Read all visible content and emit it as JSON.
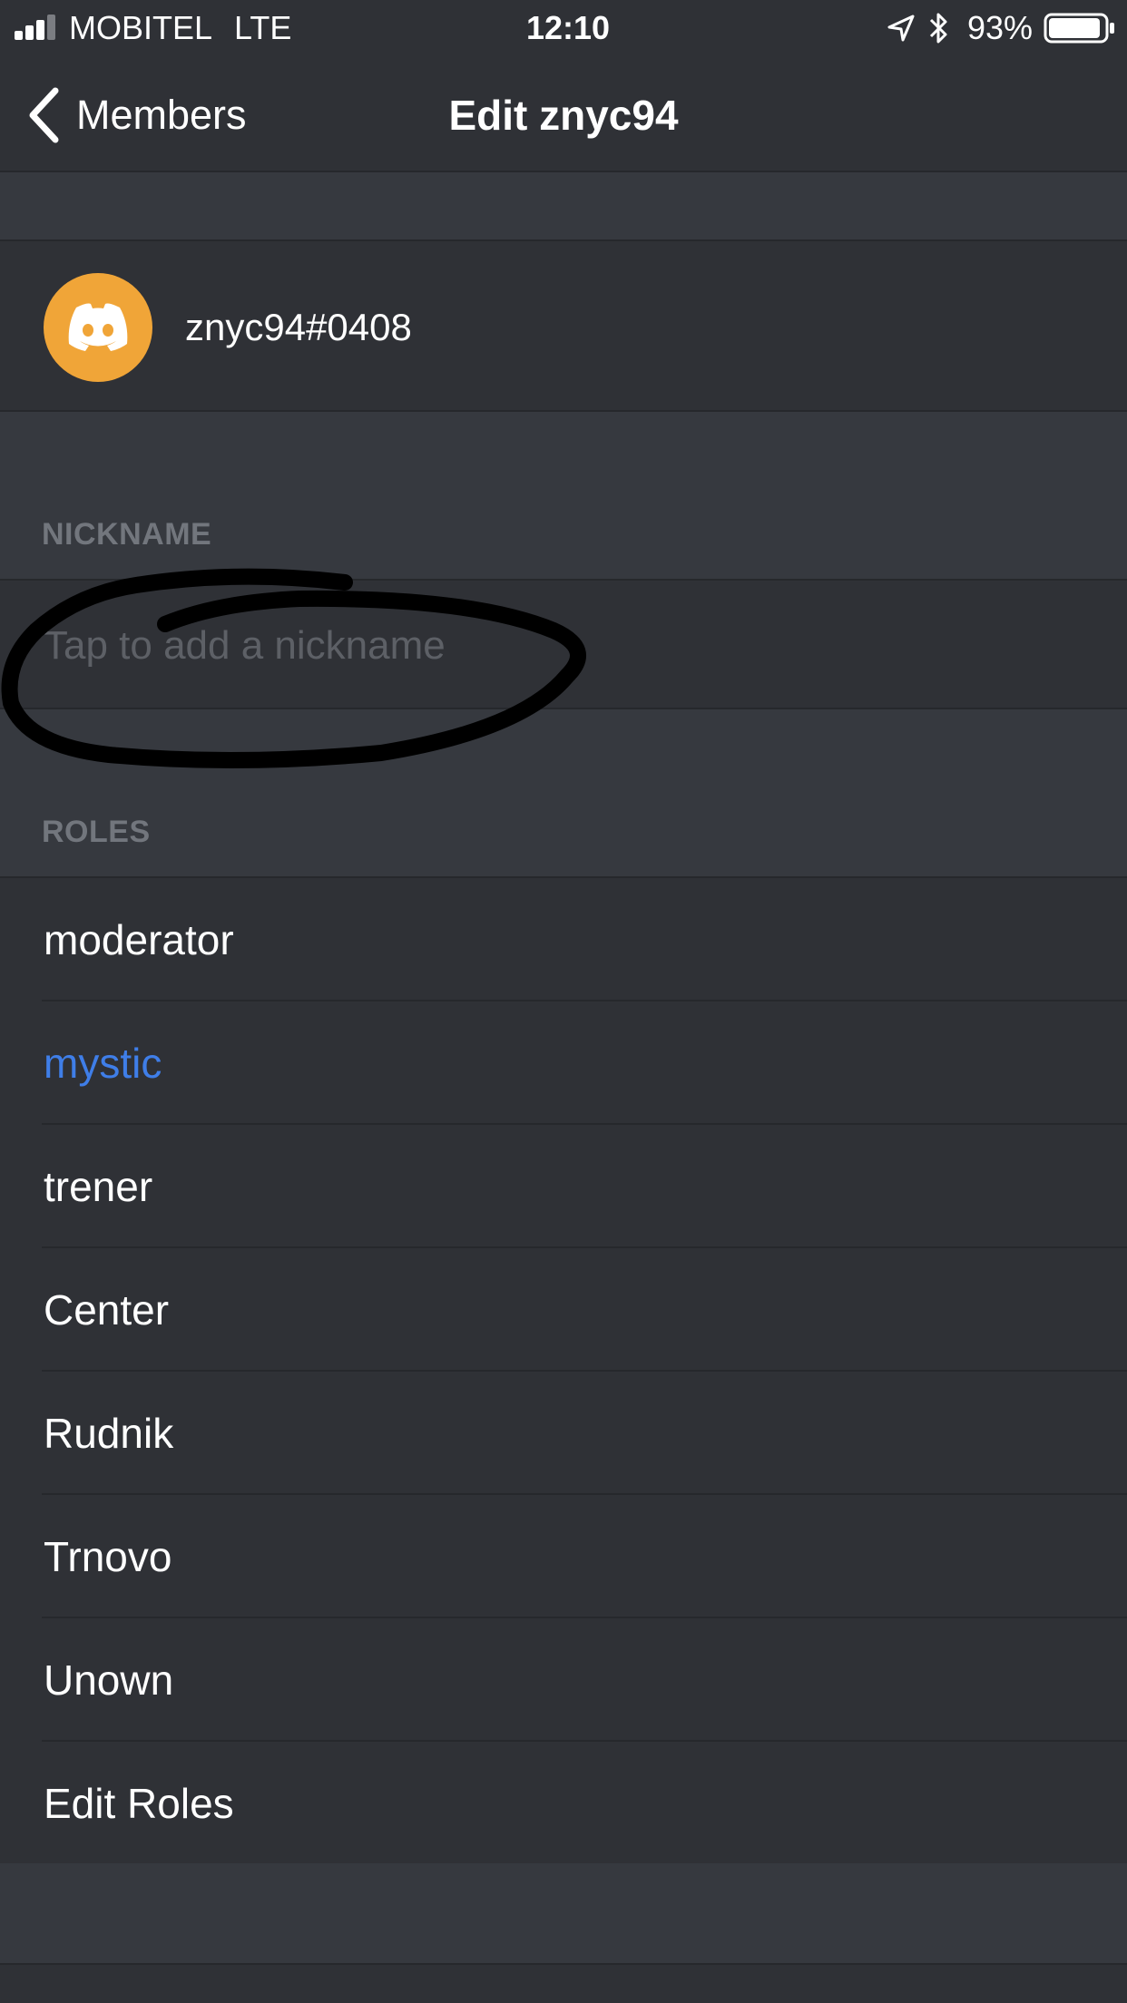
{
  "status_bar": {
    "carrier": "MOBITEL",
    "network": "LTE",
    "time": "12:10",
    "battery_percent": "93%",
    "battery_level": 0.93,
    "icons": [
      "signal-icon",
      "location-arrow-icon",
      "bluetooth-icon",
      "battery-icon"
    ]
  },
  "nav": {
    "back_label": "Members",
    "title": "Edit znyc94"
  },
  "user": {
    "username": "znyc94#0408",
    "avatar_color": "#f0a538",
    "avatar_icon": "discord-logo-icon"
  },
  "nickname": {
    "section_label": "NICKNAME",
    "placeholder": "Tap to add a nickname",
    "value": ""
  },
  "roles": {
    "section_label": "ROLES",
    "items": [
      {
        "label": "moderator",
        "color": "#ffffff"
      },
      {
        "label": "mystic",
        "color": "#3f7ee8"
      },
      {
        "label": "trener",
        "color": "#ffffff"
      },
      {
        "label": "Center",
        "color": "#ffffff"
      },
      {
        "label": "Rudnik",
        "color": "#ffffff"
      },
      {
        "label": "Trnovo",
        "color": "#ffffff"
      },
      {
        "label": "Unown",
        "color": "#ffffff"
      },
      {
        "label": "Edit Roles",
        "color": "#ffffff"
      }
    ]
  },
  "colors": {
    "background": "#2f3136",
    "section_gap": "#36393f",
    "section_label": "#72767d",
    "accent_blue": "#3f7ee8"
  }
}
